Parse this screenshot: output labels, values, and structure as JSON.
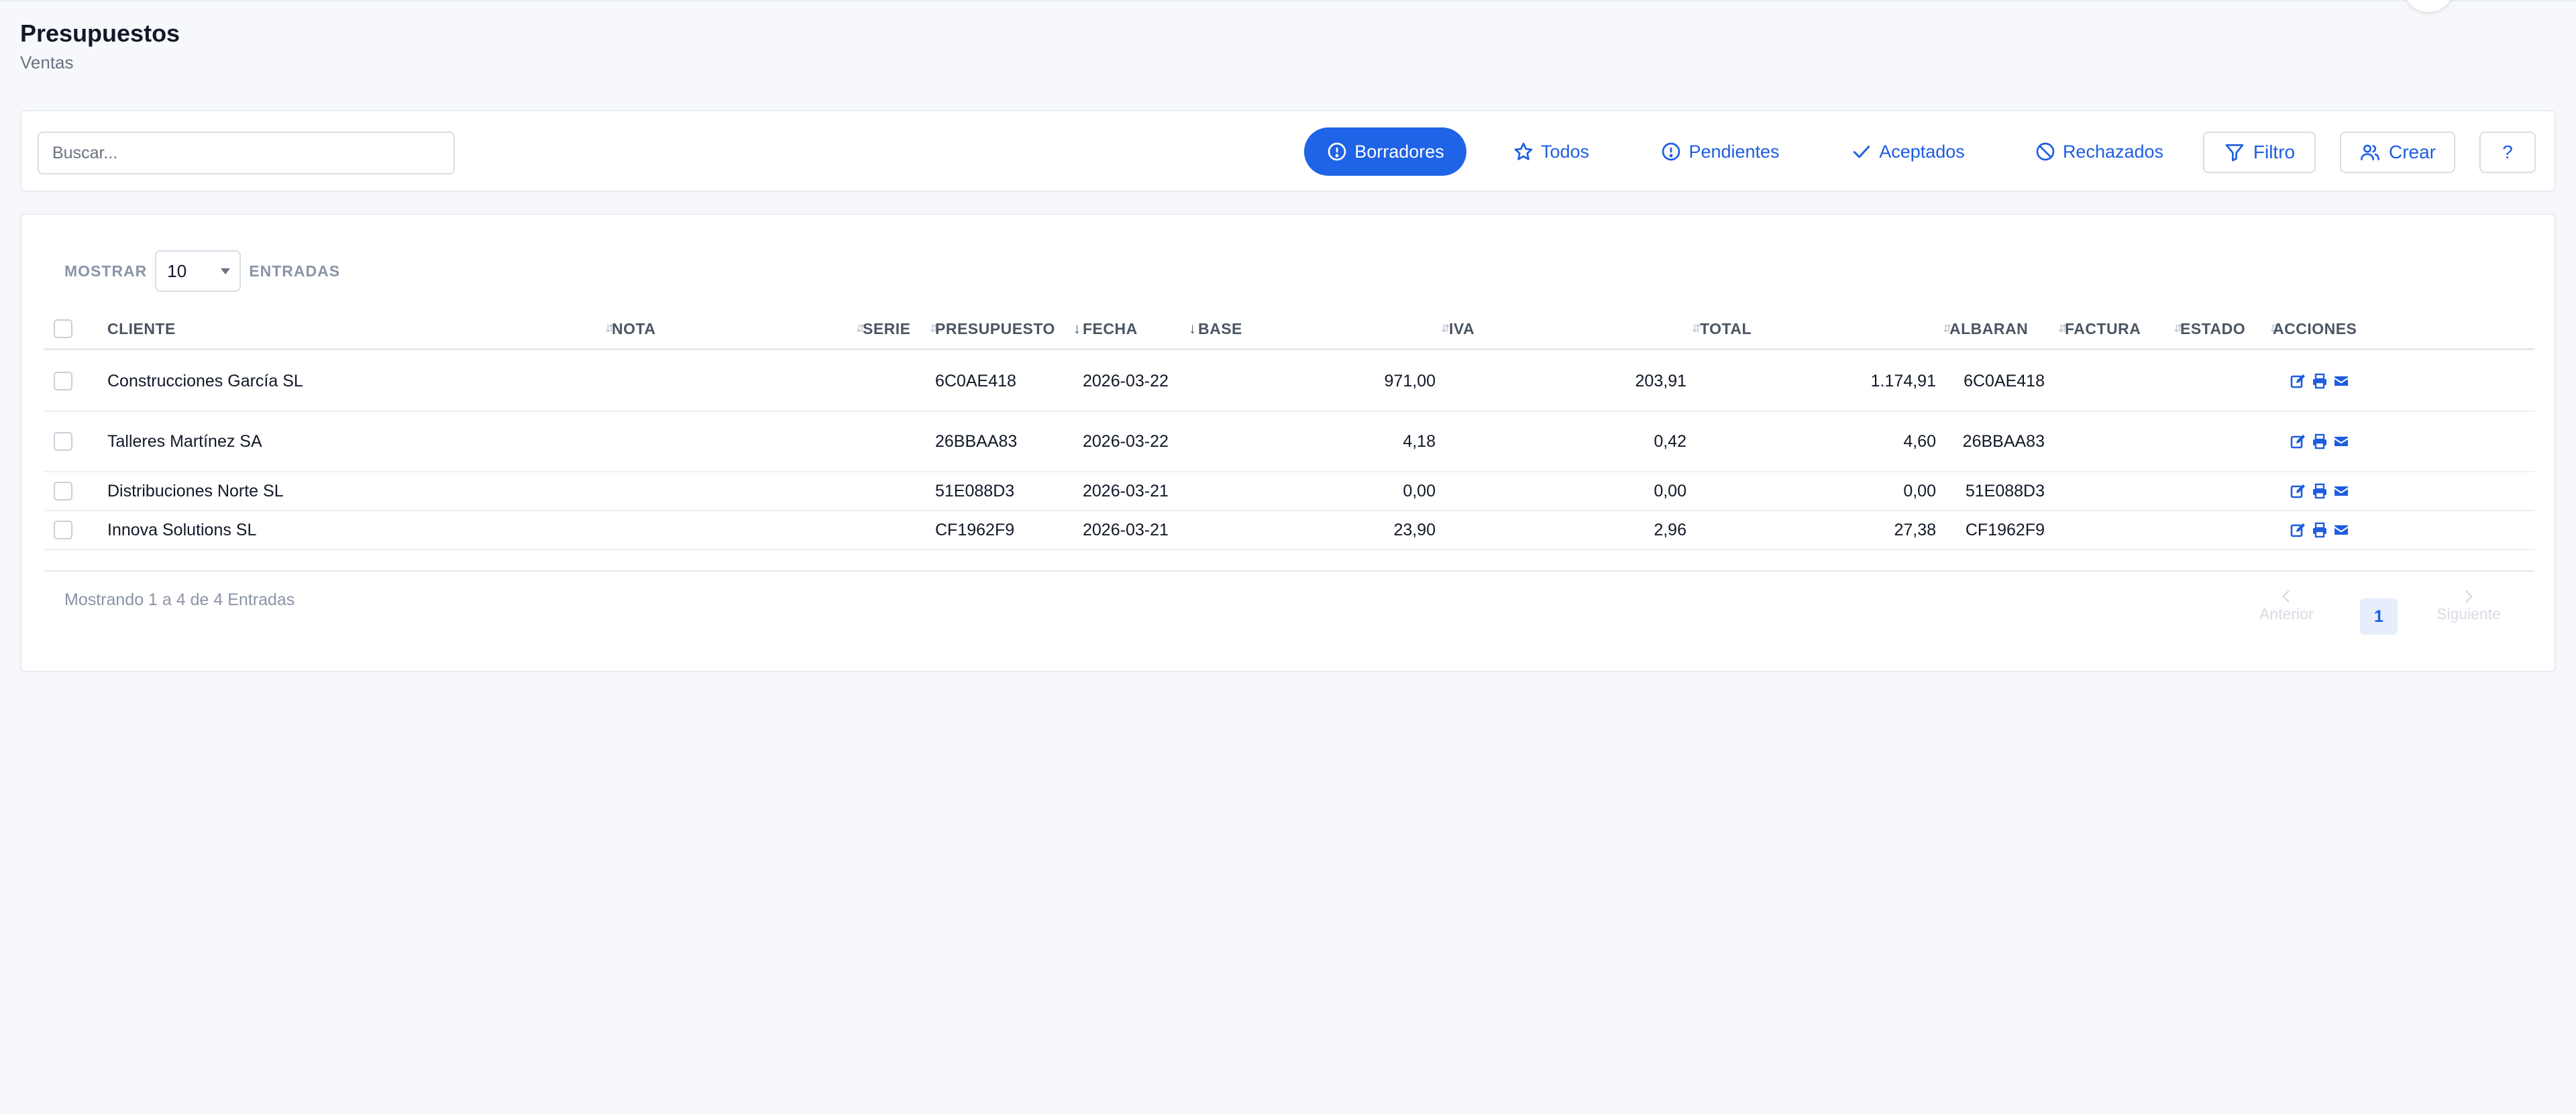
{
  "header": {
    "title": "Presupuestos",
    "subtitle": "Ventas"
  },
  "search": {
    "placeholder": "Buscar..."
  },
  "tabs": [
    {
      "label": "Borradores",
      "icon": "alert-circle-icon",
      "active": true
    },
    {
      "label": "Todos",
      "icon": "star-icon",
      "active": false
    },
    {
      "label": "Pendientes",
      "icon": "alert-circle-icon",
      "active": false
    },
    {
      "label": "Aceptados",
      "icon": "check-icon",
      "active": false
    },
    {
      "label": "Rechazados",
      "icon": "ban-icon",
      "active": false
    }
  ],
  "toolbar": {
    "filter_label": "Filtro",
    "create_label": "Crear",
    "help_label": "?"
  },
  "table": {
    "show_label": "MOSTRAR",
    "entries_label": "ENTRADAS",
    "page_size": "10",
    "columns": [
      "CLIENTE",
      "NOTA",
      "SERIE",
      "PRESUPUESTO",
      "FECHA",
      "BASE",
      "IVA",
      "TOTAL",
      "ALBARAN",
      "FACTURA",
      "ESTADO",
      "ACCIONES"
    ],
    "rows": [
      {
        "cliente": "Construcciones García SL",
        "nota": "",
        "serie": "",
        "presupuesto": "6C0AE418",
        "fecha": "2026-03-22",
        "base": "971,00",
        "iva": "203,91",
        "total": "1.174,91",
        "albaran": "6C0AE418",
        "factura": "",
        "estado": ""
      },
      {
        "cliente": "Talleres Martínez SA",
        "nota": "",
        "serie": "",
        "presupuesto": "26BBAA83",
        "fecha": "2026-03-22",
        "base": "4,18",
        "iva": "0,42",
        "total": "4,60",
        "albaran": "26BBAA83",
        "factura": "",
        "estado": ""
      },
      {
        "cliente": "Distribuciones Norte SL",
        "nota": "",
        "serie": "",
        "presupuesto": "51E088D3",
        "fecha": "2026-03-21",
        "base": "0,00",
        "iva": "0,00",
        "total": "0,00",
        "albaran": "51E088D3",
        "factura": "",
        "estado": ""
      },
      {
        "cliente": "Innova Solutions SL",
        "nota": "",
        "serie": "",
        "presupuesto": "CF1962F9",
        "fecha": "2026-03-21",
        "base": "23,90",
        "iva": "2,96",
        "total": "27,38",
        "albaran": "CF1962F9",
        "factura": "",
        "estado": ""
      }
    ],
    "footer_text": "Mostrando 1 a 4 de 4 Entradas"
  },
  "pagination": {
    "prev_label": "Anterior",
    "next_label": "Siguiente",
    "current_page": "1"
  },
  "colors": {
    "accent": "#1f63e6",
    "action_icon": "#1d5de0",
    "background": "#f6f8fb"
  }
}
